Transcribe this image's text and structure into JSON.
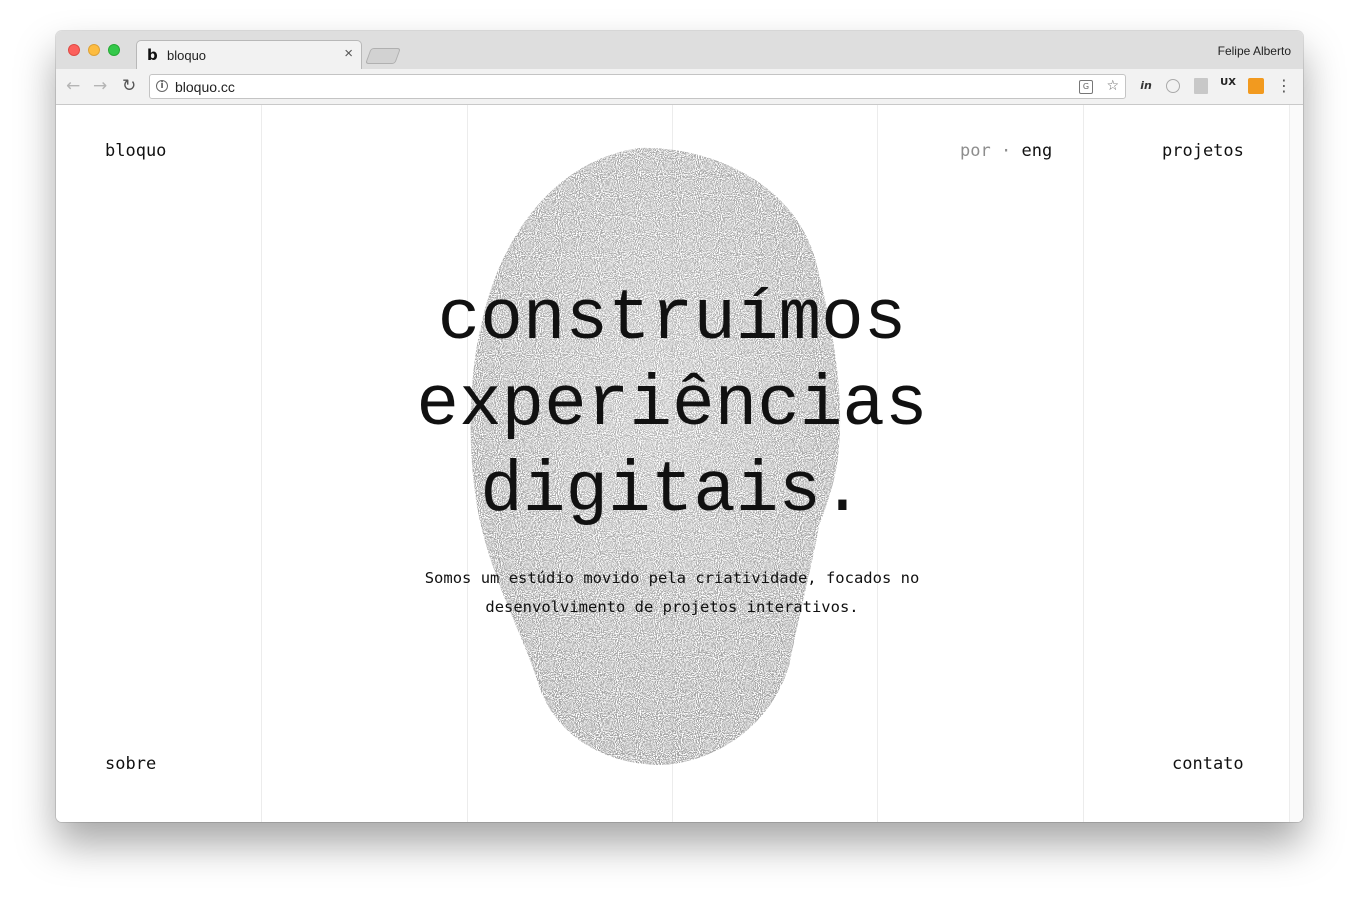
{
  "browser": {
    "tab_title": "bloquo",
    "tab_favicon": "b",
    "tab_close": "×",
    "profile_name": "Felipe Alberto",
    "url": "bloquo.cc",
    "icons": {
      "back": "←",
      "forward": "→",
      "reload": "↻",
      "info": "i",
      "translate": "G",
      "star": "☆",
      "menu": "⋮",
      "invision": "in",
      "ux": "UX"
    }
  },
  "site": {
    "logo": "bloquo",
    "languages": {
      "inactive": "por",
      "separator": "·",
      "active": "eng"
    },
    "nav_projects": "projetos",
    "nav_about": "sobre",
    "nav_contact": "contato",
    "headline": [
      "construímos",
      "experiências",
      "digitais."
    ],
    "subtitle": [
      "Somos um estúdio movido pela criatividade, focados no",
      "desenvolvimento de projetos interativos."
    ]
  },
  "colors": {
    "text": "#111111",
    "muted": "#8d8d8d",
    "gridline": "#ececec",
    "stipple": "#6b6b6b"
  }
}
